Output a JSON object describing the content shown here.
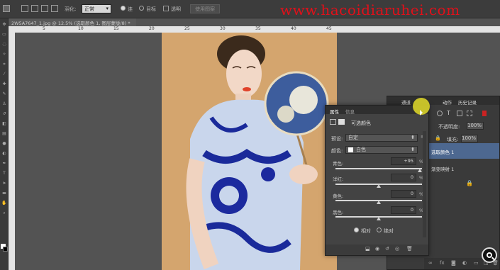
{
  "options_bar": {
    "feather_label": "羽化:",
    "mode_value": "正常",
    "radio1": "连",
    "radio2": "目标",
    "transparent_label": "透明",
    "use_pattern_btn": "使用图案"
  },
  "watermark": "www.hacoidiaruhei.com",
  "document": {
    "tab_title": "2W5A7647_1.jpg @ 12.5% (选取颜色 1, 图层蒙版/8) *",
    "ruler_marks": [
      "5",
      "10",
      "15",
      "20",
      "25",
      "30",
      "35",
      "40",
      "45"
    ]
  },
  "layers_panel": {
    "tabs": [
      "通道",
      "动作",
      "历史记录"
    ],
    "opacity_label": "不透明度:",
    "opacity_value": "100%",
    "fill_label": "填充:",
    "fill_value": "100%",
    "layers": [
      "选取颜色 1",
      "渐变映射 1"
    ]
  },
  "properties_panel": {
    "tab_properties": "属性",
    "tab_info": "信息",
    "title": "可选颜色",
    "preset_label": "预设:",
    "preset_value": "自定",
    "color_label": "颜色:",
    "color_value": "白色",
    "sliders": [
      {
        "label": "青色:",
        "value": "+95",
        "unit": "%",
        "level": 0.975
      },
      {
        "label": "洋红:",
        "value": "0",
        "unit": "%",
        "level": 0.5
      },
      {
        "label": "黄色:",
        "value": "0",
        "unit": "%",
        "level": 0.5
      },
      {
        "label": "黑色:",
        "value": "0",
        "unit": "%",
        "level": 0.5
      }
    ],
    "radio_relative": "相对",
    "radio_absolute": "绝对"
  },
  "colors": {
    "accent_yellow": "#d8d12a",
    "canvas_bg": "#d4a56e",
    "watermark_red": "#e0101a"
  }
}
